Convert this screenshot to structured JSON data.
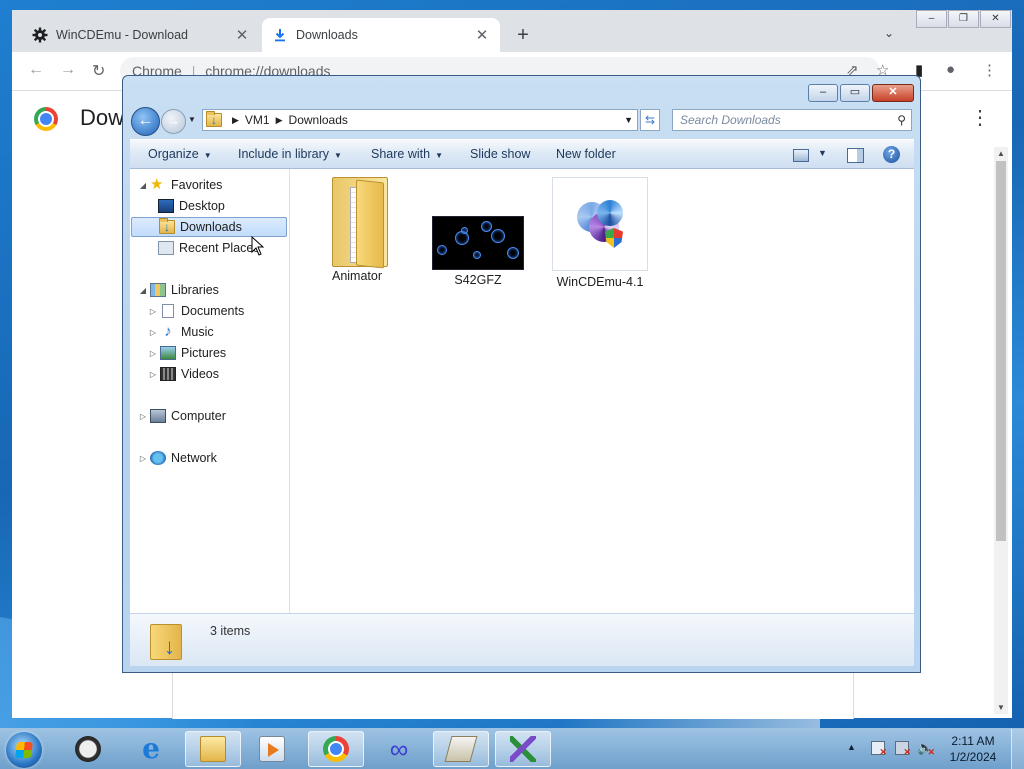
{
  "chrome": {
    "tabs": [
      {
        "label": "WinCDEmu - Download",
        "icon": "gear-icon",
        "close": "✕"
      },
      {
        "label": "Downloads",
        "icon": "download-icon",
        "close": "✕"
      }
    ],
    "new_tab": "+",
    "omnibox": {
      "site_label": "Chrome",
      "url": "chrome://downloads"
    },
    "page_title": "Downloads",
    "menu_glyph": "⋮"
  },
  "explorer": {
    "breadcrumb": [
      "VM1",
      "Downloads"
    ],
    "search_placeholder": "Search Downloads",
    "commands": [
      {
        "label": "Organize",
        "dropdown": true
      },
      {
        "label": "Include in library",
        "dropdown": true
      },
      {
        "label": "Share with",
        "dropdown": true
      },
      {
        "label": "Slide show",
        "dropdown": false
      },
      {
        "label": "New folder",
        "dropdown": false
      }
    ],
    "nav": {
      "favorites": {
        "label": "Favorites",
        "items": [
          "Desktop",
          "Downloads",
          "Recent Places"
        ]
      },
      "libraries": {
        "label": "Libraries",
        "items": [
          "Documents",
          "Music",
          "Pictures",
          "Videos"
        ]
      },
      "computer": "Computer",
      "network": "Network"
    },
    "selected_nav": "Downloads",
    "files": [
      {
        "name": "Animator",
        "kind": "folder"
      },
      {
        "name": "S42GFZ",
        "kind": "image"
      },
      {
        "name": "WinCDEmu-4.1",
        "kind": "installer"
      }
    ],
    "status": "3 items"
  },
  "taskbar": {
    "apps": [
      "clock",
      "internet-explorer",
      "windows-explorer",
      "media-player",
      "chrome",
      "infinity-app",
      "stack-app",
      "tool-app"
    ],
    "time": "2:11 AM",
    "date": "1/2/2024"
  }
}
